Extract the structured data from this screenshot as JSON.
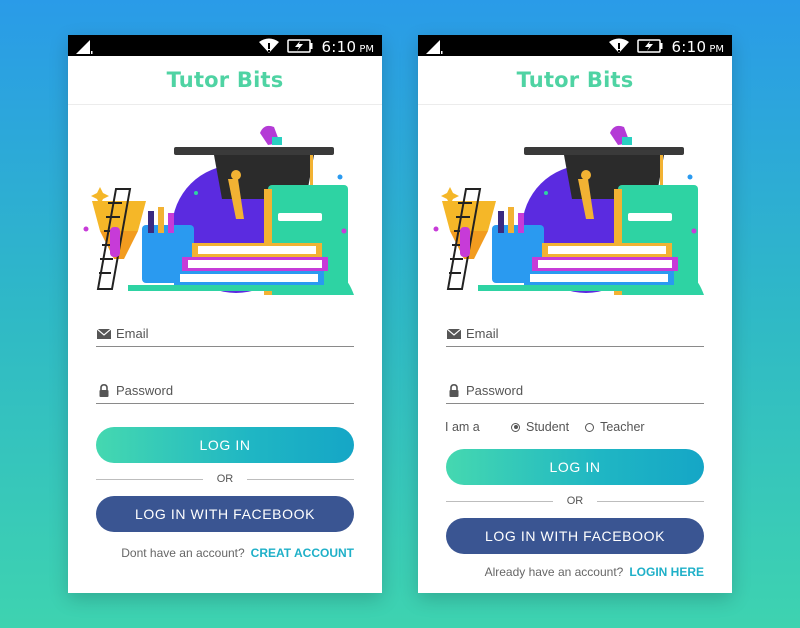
{
  "status": {
    "time": "6:10",
    "ampm": "PM"
  },
  "app": {
    "title": "Tutor Bits"
  },
  "login_screen": {
    "email_placeholder": "Email",
    "password_placeholder": "Password",
    "login_label": "LOG IN",
    "or_label": "OR",
    "facebook_label": "LOG IN WITH FACEBOOK",
    "prompt": "Dont have an account?",
    "link": "CREAT ACCOUNT"
  },
  "signup_screen": {
    "email_placeholder": "Email",
    "password_placeholder": "Password",
    "role_label": "I am a",
    "role_options": [
      "Student",
      "Teacher"
    ],
    "role_selected": "Student",
    "login_label": "LOG IN",
    "or_label": "OR",
    "facebook_label": "LOG IN WITH FACEBOOK",
    "prompt": "Already have an account?",
    "link": "LOGIN HERE"
  },
  "colors": {
    "brand": "#4fd3a3",
    "facebook": "#3a5592",
    "link": "#1fb0c8"
  },
  "icons": [
    "signal-icon",
    "wifi-icon",
    "battery-icon",
    "envelope-icon",
    "lock-icon",
    "education-illustration"
  ]
}
